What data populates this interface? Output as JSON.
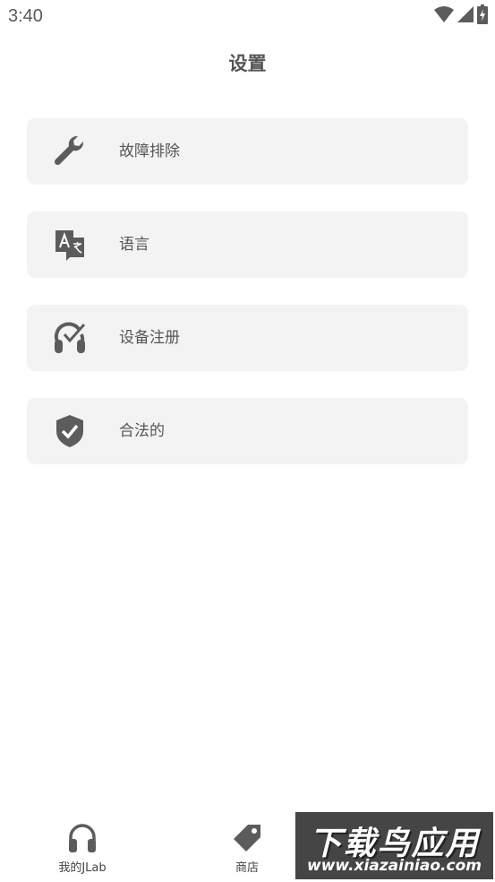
{
  "status_bar": {
    "time": "3:40",
    "icons": [
      "wifi-icon",
      "cellular-signal-icon",
      "battery-charging-icon"
    ]
  },
  "header": {
    "title": "设置"
  },
  "settings": {
    "items": [
      {
        "label": "故障排除",
        "icon": "wrench-icon"
      },
      {
        "label": "语言",
        "icon": "translate-icon"
      },
      {
        "label": "设备注册",
        "icon": "headphones-check-icon"
      },
      {
        "label": "合法的",
        "icon": "shield-check-icon"
      }
    ]
  },
  "bottom_nav": {
    "items": [
      {
        "label": "我的JLab",
        "icon": "headphones-icon"
      },
      {
        "label": "商店",
        "icon": "tag-icon"
      }
    ]
  },
  "watermark": {
    "title": "下载鸟应用",
    "url": "www.xiazainiao.com"
  },
  "colors": {
    "background": "#ffffff",
    "card": "#f3f3f3",
    "icon": "#5c5c5c",
    "text": "#555555"
  }
}
